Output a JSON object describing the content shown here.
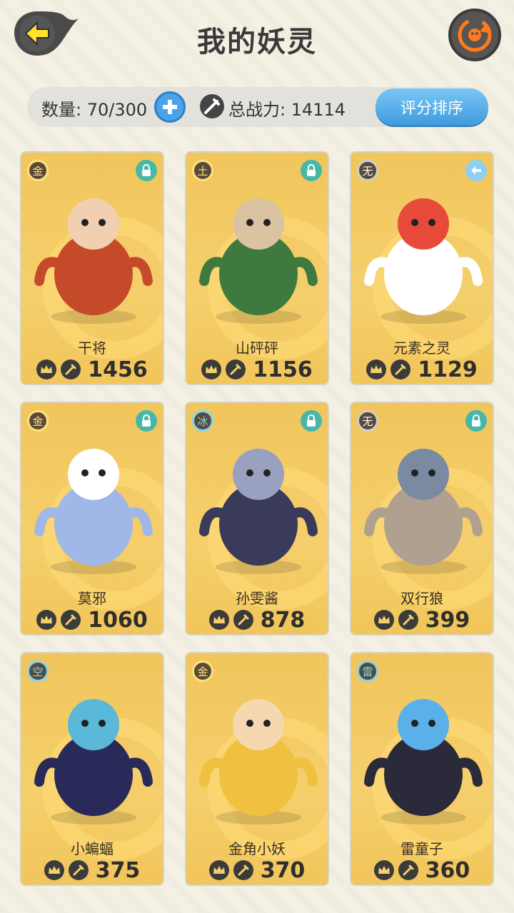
{
  "header": {
    "title": "我的妖灵"
  },
  "status": {
    "count_label": "数量: 70/300",
    "power_label": "总战力: 14114",
    "sort_label": "评分排序"
  },
  "cards": [
    {
      "element": "金",
      "name": "干将",
      "power": "1456",
      "locked": true,
      "icon": "lock-icon"
    },
    {
      "element": "土",
      "name": "山砰砰",
      "power": "1156",
      "locked": true,
      "icon": "lock-icon"
    },
    {
      "element": "无",
      "name": "元素之灵",
      "power": "1129",
      "locked": false,
      "icon": "share-icon"
    },
    {
      "element": "金",
      "name": "莫邪",
      "power": "1060",
      "locked": true,
      "icon": "lock-icon"
    },
    {
      "element": "冰",
      "name": "孙雯酱",
      "power": "878",
      "locked": true,
      "icon": "lock-icon"
    },
    {
      "element": "无",
      "name": "双行狼",
      "power": "399",
      "locked": true,
      "icon": "lock-icon"
    },
    {
      "element": "空",
      "name": "小蝙蝠",
      "power": "375",
      "locked": false,
      "icon": ""
    },
    {
      "element": "金",
      "name": "金角小妖",
      "power": "370",
      "locked": false,
      "icon": ""
    },
    {
      "element": "雷",
      "name": "雷童子",
      "power": "360",
      "locked": false,
      "icon": ""
    }
  ]
}
